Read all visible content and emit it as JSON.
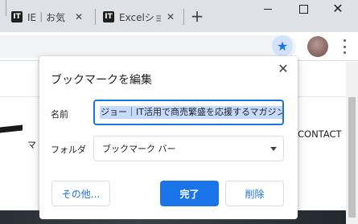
{
  "tabs": [
    {
      "title": "IE｜お気",
      "favicon": "IT"
    },
    {
      "title": "Excelショ",
      "favicon": "IT"
    }
  ],
  "page_behind": {
    "katakana_fragment": "マ",
    "nav_contact": "CONTACT"
  },
  "dialog": {
    "title": "ブックマークを編集",
    "name_label": "名前",
    "name_value": "ジョー｜IT活用で商売繁盛を応援するマガジン",
    "folder_label": "フォルダ",
    "folder_value": "ブックマーク バー",
    "more_button": "その他...",
    "done_button": "完了",
    "delete_button": "削除"
  },
  "colors": {
    "accent": "#1a73e8",
    "star_bg": "#d2e3fc",
    "selection": "#c6dafc"
  },
  "icons": {
    "star": "star-icon",
    "close": "close-icon",
    "new_tab": "plus-icon",
    "folder_dropdown": "chevron-down-icon"
  }
}
